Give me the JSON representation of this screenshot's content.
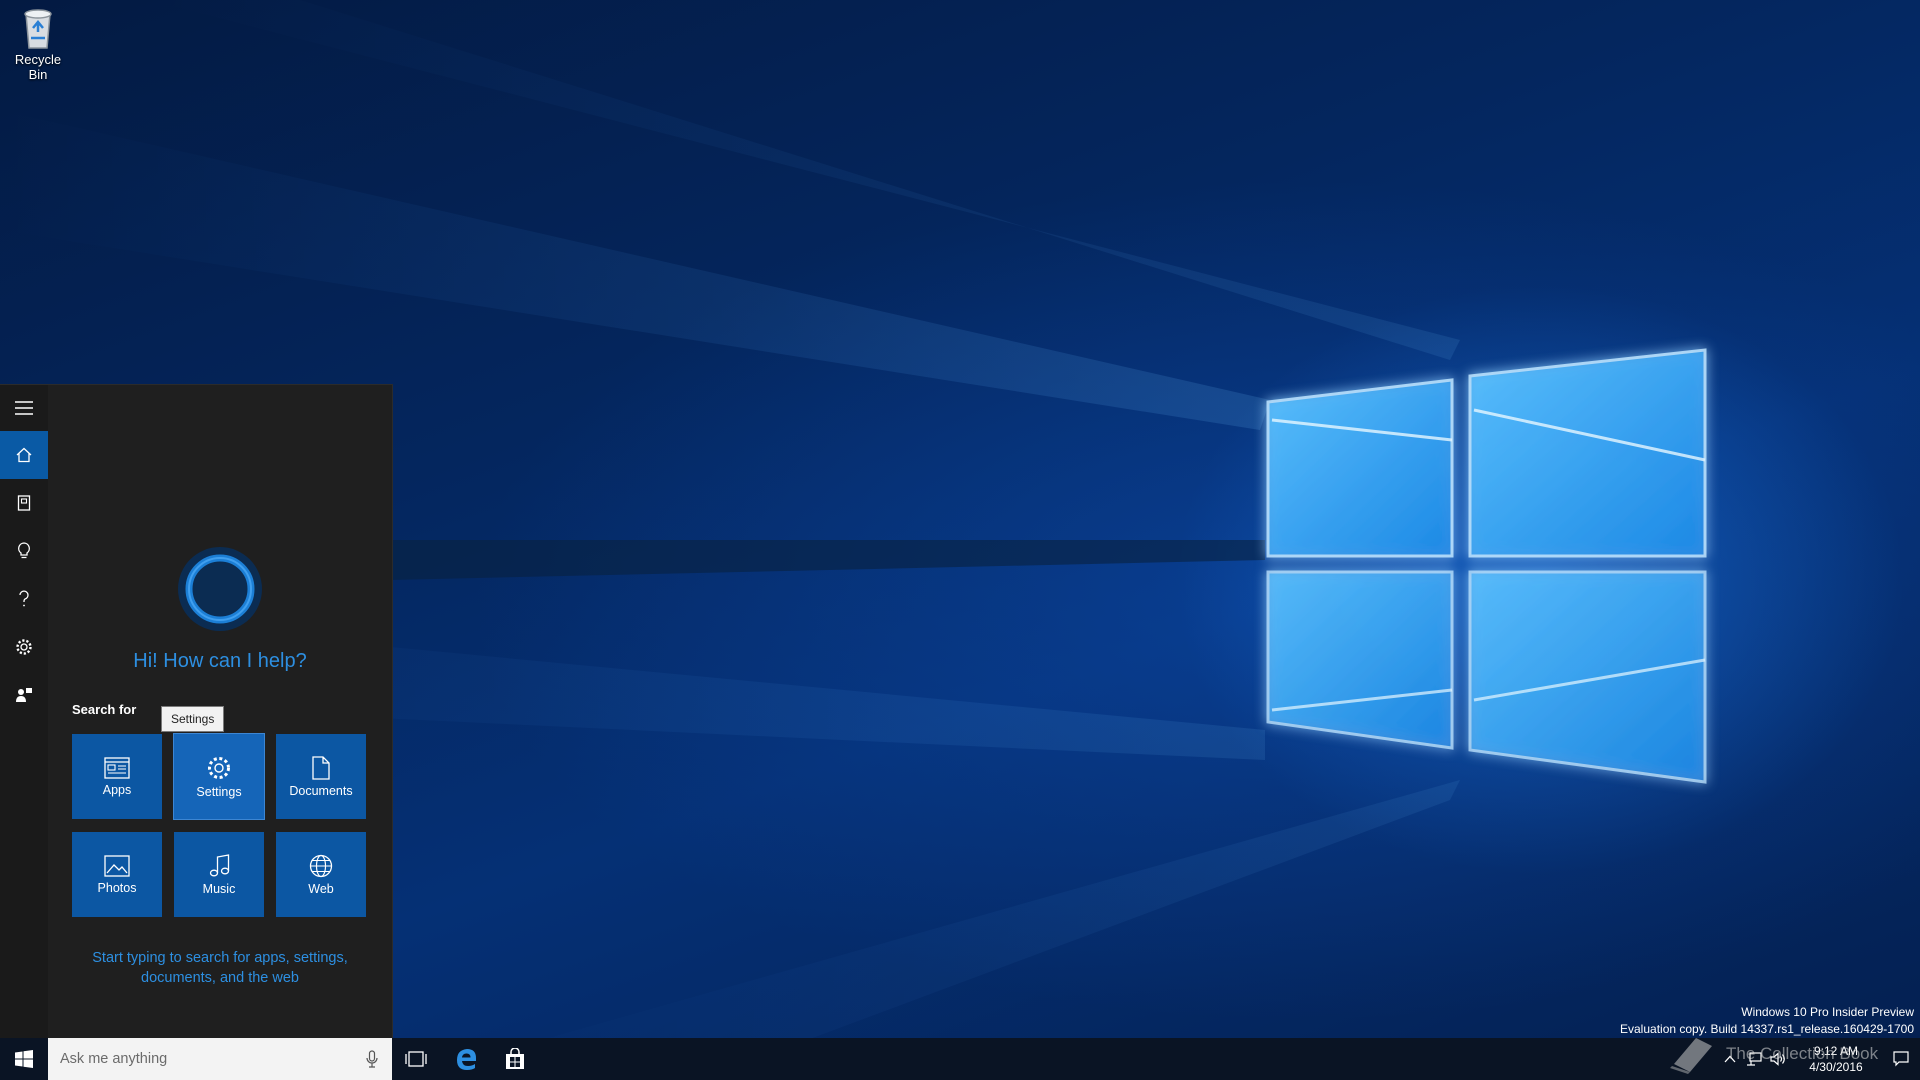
{
  "desktop": {
    "recycle_bin_label": "Recycle Bin"
  },
  "cortana": {
    "rail": [
      {
        "icon": "hamburger-menu-icon"
      },
      {
        "icon": "home-icon",
        "active": true
      },
      {
        "icon": "notebook-icon"
      },
      {
        "icon": "lightbulb-icon"
      },
      {
        "icon": "help-icon"
      },
      {
        "icon": "settings-gear-icon"
      },
      {
        "icon": "feedback-icon"
      }
    ],
    "greeting": "Hi! How can I help?",
    "search_for": "Search for",
    "tooltip": "Settings",
    "tiles": [
      {
        "label": "Apps",
        "icon": "apps-icon"
      },
      {
        "label": "Settings",
        "icon": "gear-icon"
      },
      {
        "label": "Documents",
        "icon": "document-icon"
      },
      {
        "label": "Photos",
        "icon": "photo-icon"
      },
      {
        "label": "Music",
        "icon": "music-icon"
      },
      {
        "label": "Web",
        "icon": "globe-icon"
      }
    ],
    "hint_line1": "Start typing to search for apps, settings,",
    "hint_line2": "documents, and the web",
    "accent_color": "#2d8fe1",
    "tile_color": "#0c57a3"
  },
  "taskbar": {
    "search_placeholder": "Ask me anything",
    "time": "9:12 AM",
    "date": "4/30/2016"
  },
  "watermark": {
    "line1": "Windows 10 Pro Insider Preview",
    "line2": "Evaluation copy. Build 14337.rs1_release.160429-1700"
  },
  "brand": "The Collection Book"
}
